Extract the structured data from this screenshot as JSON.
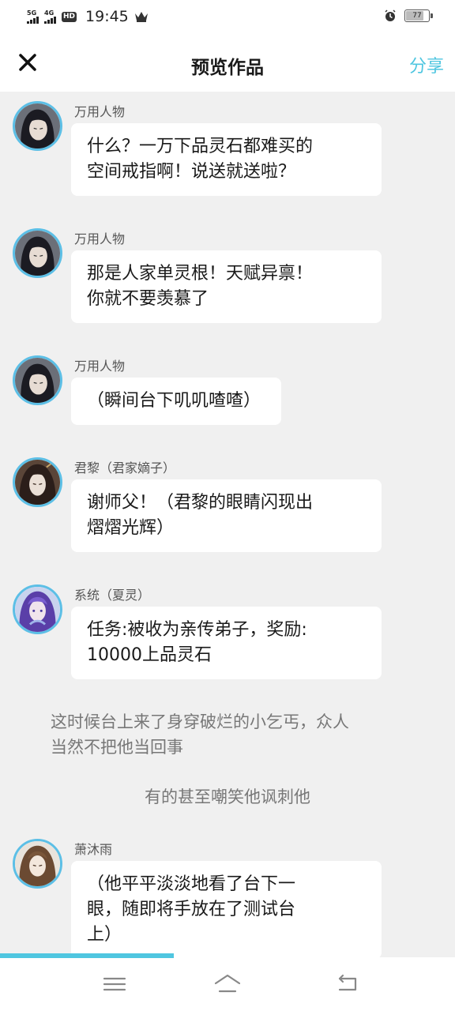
{
  "status_bar": {
    "sim1": "5G",
    "sim2": "4G",
    "hd": "HD",
    "time": "19:45",
    "battery": "77"
  },
  "header": {
    "title": "预览作品",
    "share_label": "分享"
  },
  "messages": [
    {
      "type": "dialog",
      "name": "万用人物",
      "avatar": "dark-hair-man",
      "text": "什么？一万下品灵石都难买的\n空间戒指啊！说送就送啦？"
    },
    {
      "type": "dialog",
      "name": "万用人物",
      "avatar": "dark-hair-man",
      "text": "那是人家单灵根！天赋异禀！\n你就不要羡慕了"
    },
    {
      "type": "dialog",
      "name": "万用人物",
      "avatar": "dark-hair-man",
      "text": "（瞬间台下叽叽喳喳）"
    },
    {
      "type": "dialog",
      "name": "君黎（君家嫡子）",
      "avatar": "long-hair-youth",
      "text": "谢师父！（君黎的眼睛闪现出\n熠熠光辉）"
    },
    {
      "type": "dialog",
      "name": "系统（夏灵）",
      "avatar": "purple-hair-girl",
      "text": "任务:被收为亲传弟子，奖励:\n10000上品灵石"
    },
    {
      "type": "narration",
      "text": "这时候台上来了身穿破烂的小乞丐，众人\n当然不把他当回事"
    },
    {
      "type": "narration",
      "text": "有的甚至嘲笑他讽刺他"
    },
    {
      "type": "dialog",
      "name": "萧沐雨",
      "avatar": "brown-hair-youth",
      "text": "（他平平淡淡地看了台下一\n眼，随即将手放在了测试台\n上）"
    }
  ],
  "icons": {
    "close": "close-icon",
    "menu": "menu-icon",
    "home": "home-icon",
    "back": "back-icon",
    "alarm": "alarm-icon",
    "crown": "crown-icon"
  },
  "colors": {
    "accent": "#4fc6e0",
    "chat_bg": "#f0f0f0",
    "avatar_ring": "#5cbfe6"
  }
}
